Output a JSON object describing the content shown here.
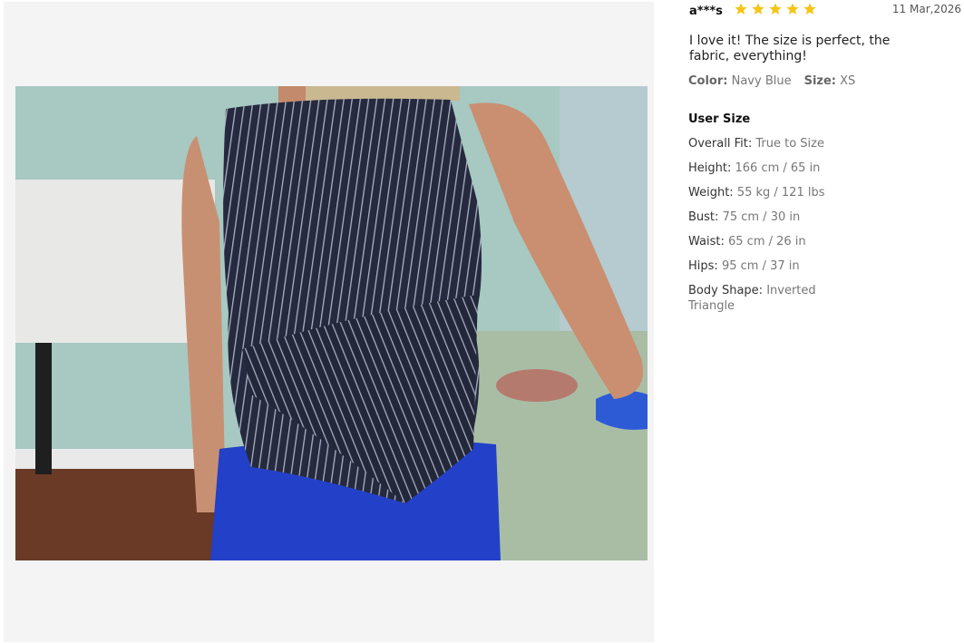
{
  "review": {
    "username": "a***s",
    "rating": 5,
    "date": "11 Mar,2026",
    "text": "I love it! The size is perfect, the fabric, everything!",
    "color_label": "Color:",
    "color_value": "Navy Blue",
    "size_label": "Size:",
    "size_value": "XS",
    "star_color": "#f5c518"
  },
  "user_size": {
    "title": "User Size",
    "rows": [
      {
        "label": "Overall Fit:",
        "value": "True to Size"
      },
      {
        "label": "Height:",
        "value": "166 cm / 65 in"
      },
      {
        "label": "Weight:",
        "value": "55 kg / 121 lbs"
      },
      {
        "label": "Bust:",
        "value": "75 cm / 30 in"
      },
      {
        "label": "Waist:",
        "value": "65 cm / 26 in"
      },
      {
        "label": "Hips:",
        "value": "95 cm / 37 in"
      },
      {
        "label": "Body Shape:",
        "value": "Inverted Triangle"
      }
    ]
  }
}
